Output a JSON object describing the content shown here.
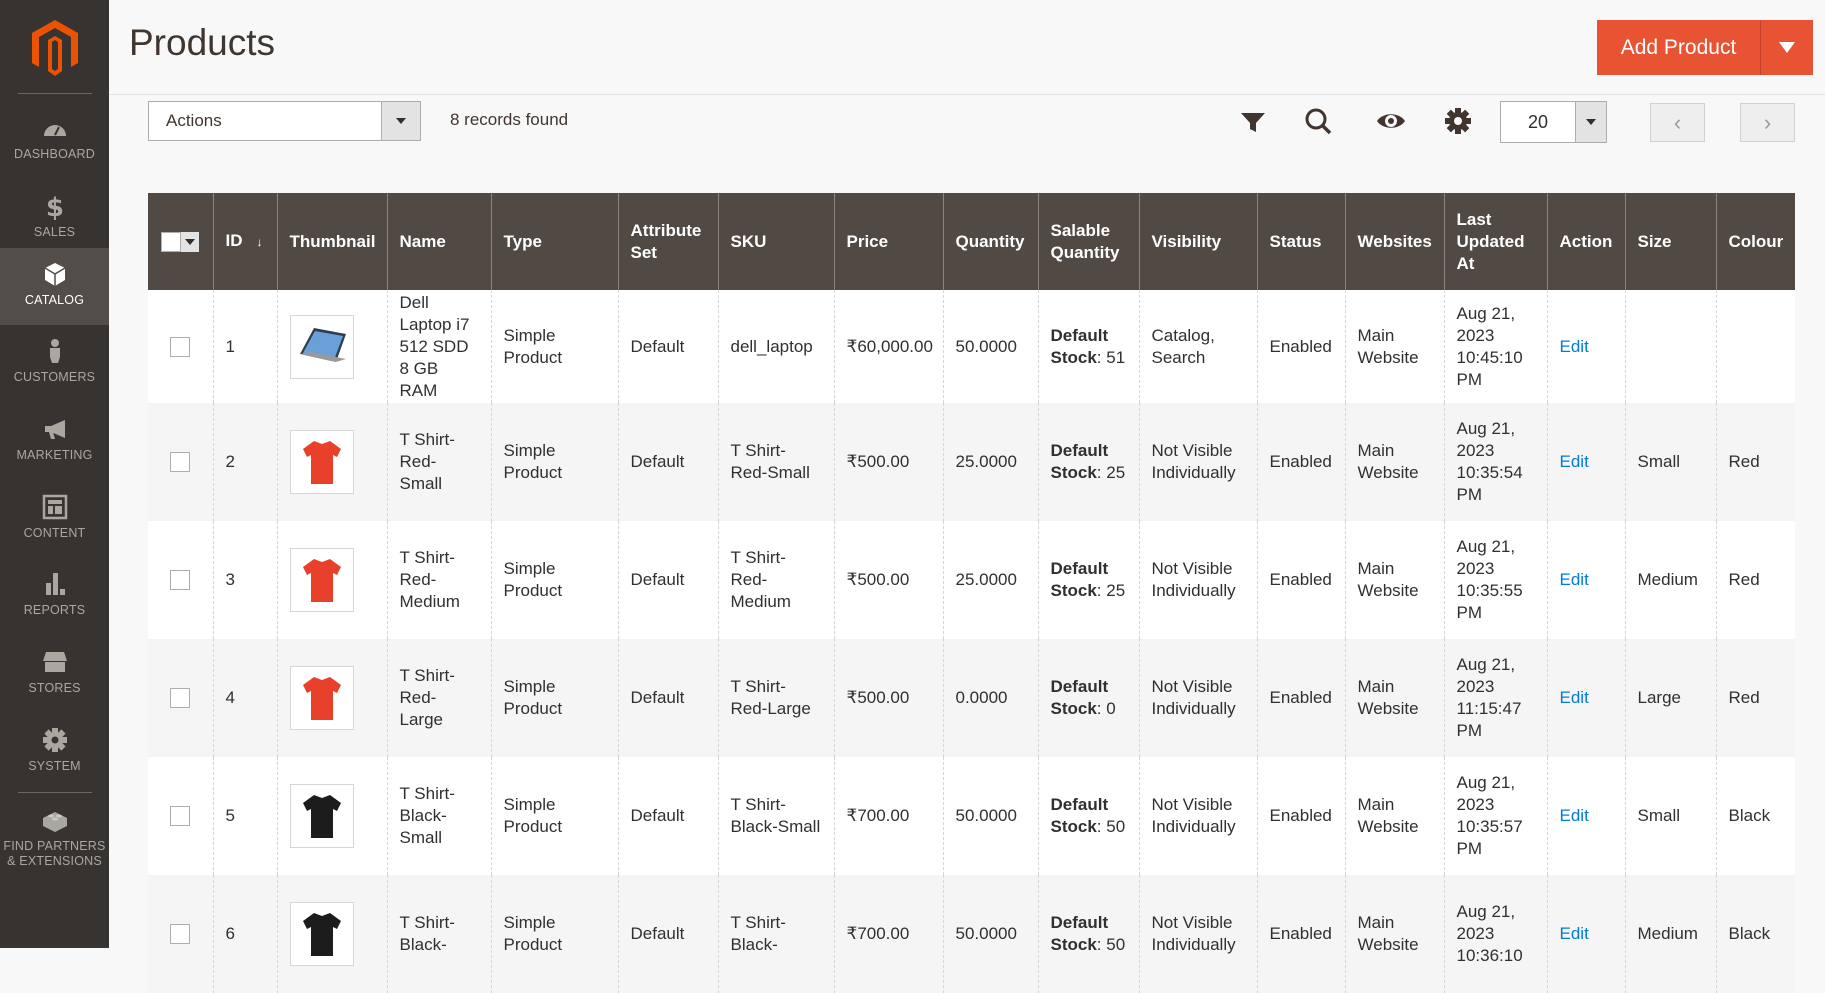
{
  "sidebar": {
    "items": [
      {
        "label": "DASHBOARD",
        "icon": "dashboard-icon"
      },
      {
        "label": "SALES",
        "icon": "dollar-icon"
      },
      {
        "label": "CATALOG",
        "icon": "box-icon",
        "active": true
      },
      {
        "label": "CUSTOMERS",
        "icon": "person-icon"
      },
      {
        "label": "MARKETING",
        "icon": "megaphone-icon"
      },
      {
        "label": "CONTENT",
        "icon": "layout-icon"
      },
      {
        "label": "REPORTS",
        "icon": "bar-chart-icon"
      },
      {
        "label": "STORES",
        "icon": "storefront-icon"
      },
      {
        "label": "SYSTEM",
        "icon": "gear-icon"
      },
      {
        "label": "FIND PARTNERS",
        "label2": "& EXTENSIONS",
        "icon": "lego-brick-icon"
      }
    ]
  },
  "header": {
    "title": "Products",
    "add_button": "Add Product"
  },
  "toolbar": {
    "actions_label": "Actions",
    "records": "8 records found",
    "per_page": "20"
  },
  "colors": {
    "accent": "#e85433",
    "header_bg": "#514943",
    "sidebar_bg": "#373330",
    "link": "#007bdb"
  },
  "grid": {
    "columns": [
      "ID",
      "Thumbnail",
      "Name",
      "Type",
      "Attribute Set",
      "SKU",
      "Price",
      "Quantity",
      "Salable Quantity",
      "Visibility",
      "Status",
      "Websites",
      "Last Updated At",
      "Action",
      "Size",
      "Colour"
    ],
    "rows": [
      {
        "id": "1",
        "thumb": "laptop",
        "name": "Dell Laptop i7 512 SDD 8 GB RAM",
        "type": "Simple Product",
        "set": "Default",
        "sku": "dell_laptop",
        "price": "₹60,000.00",
        "qty": "50.0000",
        "salable_label": "Default Stock",
        "salable": "51",
        "visibility": "Catalog, Search",
        "status": "Enabled",
        "websites": "Main Website",
        "updated": "Aug 21, 2023 10:45:10 PM",
        "action": "Edit",
        "size": "",
        "colour": ""
      },
      {
        "id": "2",
        "thumb": "red",
        "name": "T Shirt-Red-Small",
        "type": "Simple Product",
        "set": "Default",
        "sku": "T Shirt-Red-Small",
        "price": "₹500.00",
        "qty": "25.0000",
        "salable_label": "Default Stock",
        "salable": "25",
        "visibility": "Not Visible Individually",
        "status": "Enabled",
        "websites": "Main Website",
        "updated": "Aug 21, 2023 10:35:54 PM",
        "action": "Edit",
        "size": "Small",
        "colour": "Red"
      },
      {
        "id": "3",
        "thumb": "red",
        "name": "T Shirt-Red-Medium",
        "type": "Simple Product",
        "set": "Default",
        "sku": "T Shirt-Red-Medium",
        "price": "₹500.00",
        "qty": "25.0000",
        "salable_label": "Default Stock",
        "salable": "25",
        "visibility": "Not Visible Individually",
        "status": "Enabled",
        "websites": "Main Website",
        "updated": "Aug 21, 2023 10:35:55 PM",
        "action": "Edit",
        "size": "Medium",
        "colour": "Red"
      },
      {
        "id": "4",
        "thumb": "red",
        "name": "T Shirt-Red-Large",
        "type": "Simple Product",
        "set": "Default",
        "sku": "T Shirt-Red-Large",
        "price": "₹500.00",
        "qty": "0.0000",
        "salable_label": "Default Stock",
        "salable": "0",
        "visibility": "Not Visible Individually",
        "status": "Enabled",
        "websites": "Main Website",
        "updated": "Aug 21, 2023 11:15:47 PM",
        "action": "Edit",
        "size": "Large",
        "colour": "Red"
      },
      {
        "id": "5",
        "thumb": "black",
        "name": "T Shirt-Black-Small",
        "type": "Simple Product",
        "set": "Default",
        "sku": "T Shirt-Black-Small",
        "price": "₹700.00",
        "qty": "50.0000",
        "salable_label": "Default Stock",
        "salable": "50",
        "visibility": "Not Visible Individually",
        "status": "Enabled",
        "websites": "Main Website",
        "updated": "Aug 21, 2023 10:35:57 PM",
        "action": "Edit",
        "size": "Small",
        "colour": "Black"
      },
      {
        "id": "6",
        "thumb": "black",
        "name": "T Shirt-Black-",
        "type": "Simple Product",
        "set": "Default",
        "sku": "T Shirt-Black-",
        "price": "₹700.00",
        "qty": "50.0000",
        "salable_label": "Default Stock",
        "salable": "50",
        "visibility": "Not Visible Individually",
        "status": "Enabled",
        "websites": "Main Website",
        "updated": "Aug 21, 2023 10:36:10",
        "action": "Edit",
        "size": "Medium",
        "colour": "Black"
      }
    ]
  }
}
